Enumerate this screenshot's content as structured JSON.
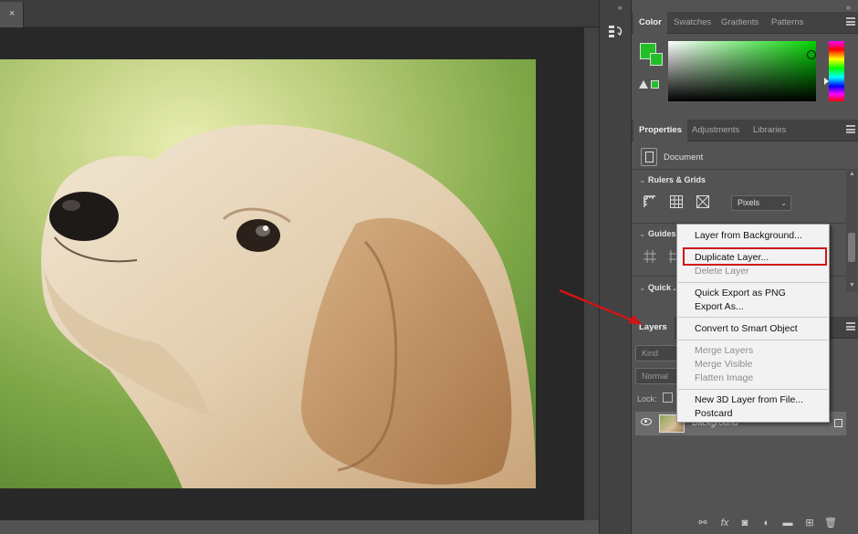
{
  "document": {
    "tab_close_glyph": "×",
    "canvas_background": "#282828"
  },
  "toolstrip": {
    "collapse_glyph": "«",
    "collapse_right_glyph": "»"
  },
  "color_panel": {
    "tabs": [
      "Color",
      "Swatches",
      "Gradients",
      "Patterns"
    ],
    "foreground_color": "#22c026"
  },
  "properties_panel": {
    "tabs": [
      "Properties",
      "Adjustments",
      "Libraries"
    ],
    "document_label": "Document",
    "sections": {
      "rulers": "Rulers & Grids",
      "guides": "Guides",
      "quick": "Quick ..."
    },
    "units_value": "Pixels"
  },
  "layers_panel": {
    "tab": "Layers",
    "kind_placeholder": "Kind",
    "blend_mode": "Normal",
    "lock_label": "Lock:",
    "layer_name": "Background"
  },
  "context_menu": {
    "items": [
      {
        "label": "Layer from Background...",
        "enabled": true
      },
      {
        "label": "Duplicate Layer...",
        "enabled": true,
        "highlighted": true
      },
      {
        "label": "Delete Layer",
        "enabled": false
      },
      {
        "label": "Quick Export as PNG",
        "enabled": true
      },
      {
        "label": "Export As...",
        "enabled": true
      },
      {
        "label": "Convert to Smart Object",
        "enabled": true
      },
      {
        "label": "Merge Layers",
        "enabled": false
      },
      {
        "label": "Merge Visible",
        "enabled": false
      },
      {
        "label": "Flatten Image",
        "enabled": false
      },
      {
        "label": "New 3D Layer from File...",
        "enabled": true
      },
      {
        "label": "Postcard",
        "enabled": true
      }
    ]
  },
  "colors": {
    "annotation": "#d01515",
    "panel": "#535353",
    "tabbar": "#424242"
  }
}
